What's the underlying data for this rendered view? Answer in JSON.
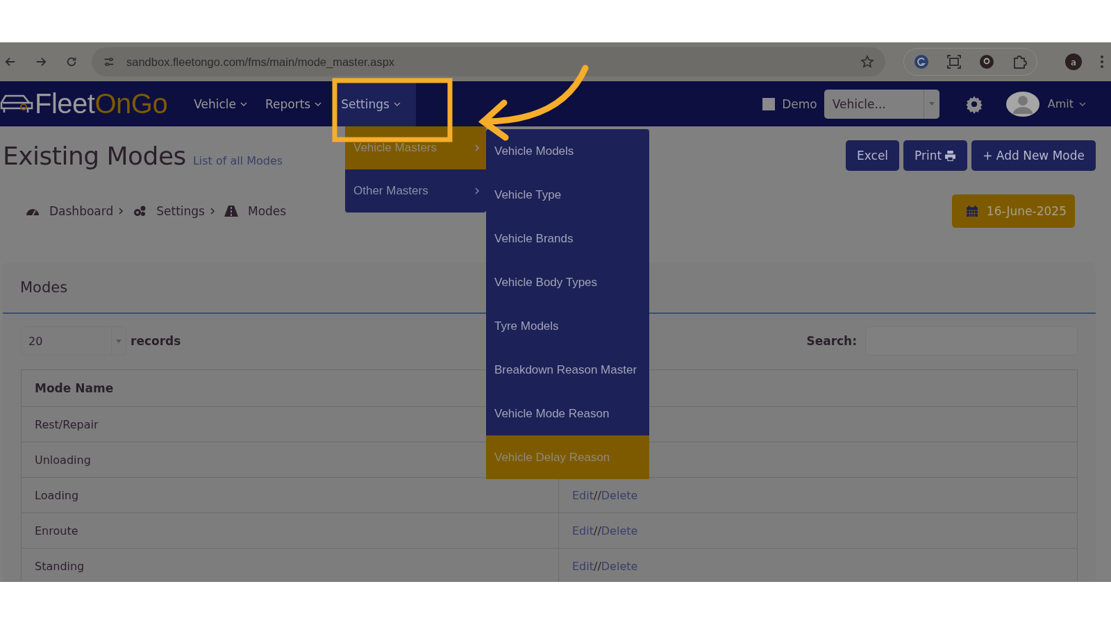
{
  "browser": {
    "url": "sandbox.fleetongo.com/fms/main/mode_master.aspx",
    "profile_initial": "a"
  },
  "navbar": {
    "logo": {
      "first": "Fleet",
      "second": "OnGo"
    },
    "items": [
      {
        "label": "Vehicle",
        "selected": false
      },
      {
        "label": "Reports",
        "selected": false
      },
      {
        "label": "Settings",
        "selected": true
      }
    ],
    "demo": {
      "label": "Demo",
      "checked": false
    },
    "vehicle_select": {
      "value": "Vehicle..."
    },
    "user": {
      "name": "Amit"
    }
  },
  "settings_menu": {
    "items": [
      {
        "label": "Vehicle Masters",
        "selected": true
      },
      {
        "label": "Other Masters",
        "selected": false
      }
    ],
    "submenu": [
      {
        "label": "Vehicle Models",
        "selected": false
      },
      {
        "label": "Vehicle Type",
        "selected": false
      },
      {
        "label": "Vehicle Brands",
        "selected": false
      },
      {
        "label": "Vehicle Body Types",
        "selected": false
      },
      {
        "label": "Tyre Models",
        "selected": false
      },
      {
        "label": "Breakdown Reason Master",
        "selected": false
      },
      {
        "label": "Vehicle Mode Reason",
        "selected": false
      },
      {
        "label": "Vehicle Delay Reason",
        "selected": true
      }
    ]
  },
  "page": {
    "title": "Existing Modes",
    "subtitle": "List of all Modes",
    "buttons": [
      {
        "label": "Excel",
        "kind": "plain"
      },
      {
        "label": "Print",
        "kind": "print"
      },
      {
        "label": "+ Add New Mode",
        "kind": "plain"
      }
    ],
    "breadcrumb": [
      {
        "label": "Dashboard",
        "kind": "dashboard"
      },
      {
        "label": "Settings",
        "kind": "settings"
      },
      {
        "label": "Modes",
        "kind": "road"
      }
    ],
    "date": "16-June-2025"
  },
  "card": {
    "title": "Modes",
    "page_size": "20",
    "records_label": "records",
    "search_label": "Search:",
    "table": {
      "columns": [
        "Mode Name"
      ],
      "rows": [
        {
          "mode": "Rest/Repair"
        },
        {
          "mode": "Unloading"
        },
        {
          "mode": "Loading",
          "edit": "Edit",
          "separator": "//",
          "delete": "Delete"
        },
        {
          "mode": "Enroute",
          "edit": "Edit",
          "separator": "//",
          "delete": "Delete"
        },
        {
          "mode": "Standing",
          "edit": "Edit",
          "separator": "//",
          "delete": "Delete"
        }
      ]
    }
  }
}
